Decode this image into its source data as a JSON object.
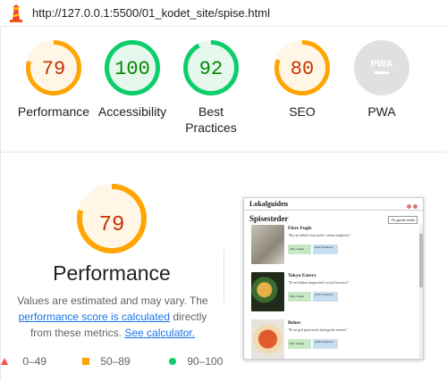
{
  "address_bar": {
    "url": "http://127.0.0.1:5500/01_kodet_site/spise.html"
  },
  "colors": {
    "pass": "#0cce6b",
    "average": "#ffa400",
    "fail": "#ff4e42",
    "na": "#ddd",
    "pass_text": "#008800",
    "avg_text": "#c33300"
  },
  "summary": [
    {
      "name": "Performance",
      "score": "79",
      "pct": 79,
      "level": "average"
    },
    {
      "name": "Accessibility",
      "score": "100",
      "pct": 100,
      "level": "pass"
    },
    {
      "name": "Best Practices",
      "score": "92",
      "pct": 92,
      "level": "pass"
    },
    {
      "name": "SEO",
      "score": "80",
      "pct": 80,
      "level": "average"
    },
    {
      "name": "PWA",
      "score": "PWA",
      "pct": 0,
      "level": "na"
    }
  ],
  "category": {
    "score": "79",
    "pct": 79,
    "title": "Performance",
    "note_before": "Values are estimated and may vary. The",
    "note_link": "performance score is calculated",
    "note_mid": "directly from these metrics.",
    "note_calc": "See calculator."
  },
  "legend": [
    {
      "shape": "triangle",
      "range": "0–49"
    },
    {
      "shape": "square",
      "range": "50–89"
    },
    {
      "shape": "circle",
      "range": "90–100"
    }
  ],
  "screenshot": {
    "app_title": "Lokalguiden",
    "heading": "Spisesteder",
    "top_button": "Vis gamle steder",
    "cards": [
      {
        "title": "Flere Fugle",
        "desc": "\"Hyl en lækker kop kaffe i urban singleton\"",
        "btn1": "Åbn i maps",
        "btn2": "Gem til senere"
      },
      {
        "title": "Tokyo Eatery",
        "desc": "\"Et en lækker burgersted i social hotvrast!\"",
        "btn1": "Åbn i maps",
        "btn2": "Gem til senere"
      },
      {
        "title": "Behov",
        "desc": "\"Et en god pizza med akologiske råvarer\"",
        "btn1": "Åbn i maps",
        "btn2": "Gem til senere"
      }
    ]
  }
}
